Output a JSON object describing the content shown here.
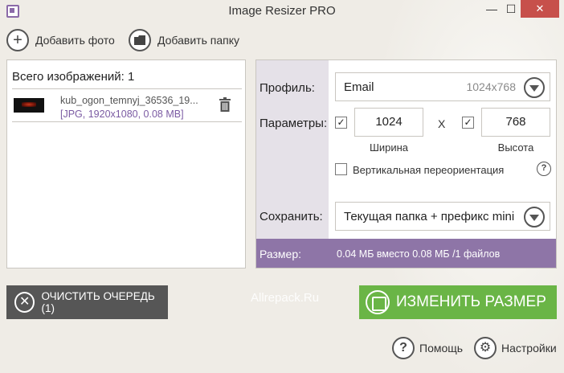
{
  "window": {
    "title": "Image Resizer PRO",
    "minimize": "—",
    "maximize": "☐",
    "close": "✕"
  },
  "toolbar": {
    "add_photo": "Добавить фото",
    "add_folder": "Добавить папку"
  },
  "queue": {
    "total_label": "Всего изображений: 1",
    "files": [
      {
        "name": "kub_ogon_temnyj_36536_19...",
        "meta": "[JPG, 1920x1080, 0.08 MB]"
      }
    ]
  },
  "settings": {
    "profile_label": "Профиль:",
    "profile_value": "Email",
    "profile_size": "1024x768",
    "params_label": "Параметры:",
    "width_value": "1024",
    "width_checked": "✓",
    "times": "X",
    "height_value": "768",
    "height_checked": "✓",
    "width_label": "Ширина",
    "height_label": "Высота",
    "reorient_label": "Вертикальная переориентация",
    "help": "?",
    "save_label": "Сохранить:",
    "save_value": "Текущая папка + префикс mini",
    "size_label": "Размер:",
    "size_value": "0.04 МБ вместо 0.08 МБ /1 файлов"
  },
  "actions": {
    "clear_queue": "ОЧИСТИТЬ ОЧЕРЕДЬ (1)",
    "resize": "ИЗМЕНИТЬ РАЗМЕР",
    "help": "Помощь",
    "settings": "Настройки"
  },
  "watermark": "Allrepack.Ru",
  "colors": {
    "accent_purple": "#8e75a7",
    "resize_green": "#6ab546",
    "clear_gray": "#565656",
    "close_red": "#c7504b"
  }
}
